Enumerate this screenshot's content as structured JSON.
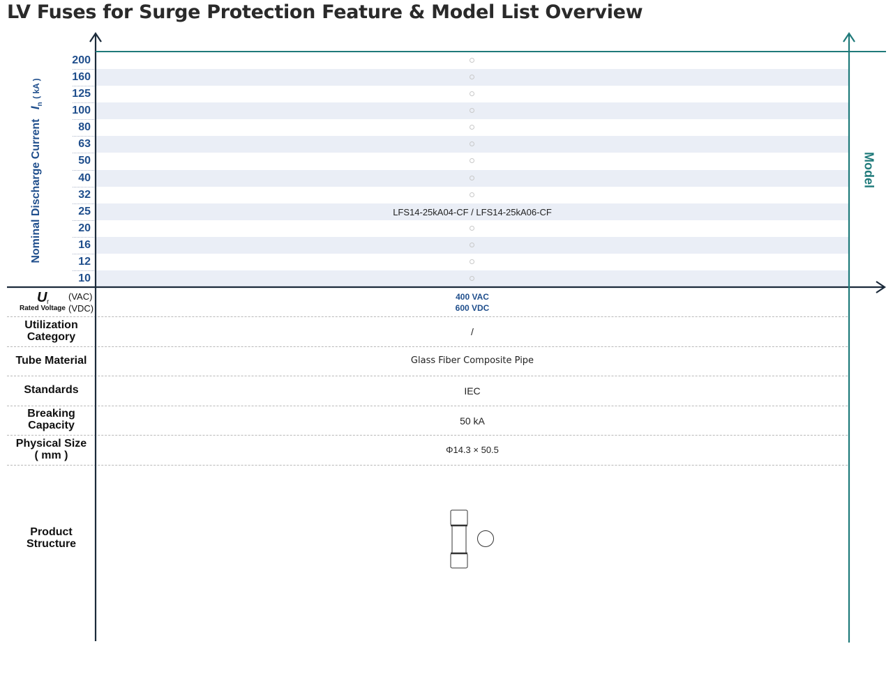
{
  "title": "LV Fuses for Surge Protection Feature & Model List Overview",
  "y_axis": {
    "symbol": "I",
    "subscript": "n",
    "label": "Nominal Discharge Current",
    "unit": "( kA )",
    "values": [
      "200",
      "160",
      "125",
      "100",
      "80",
      "63",
      "50",
      "40",
      "32",
      "25",
      "20",
      "16",
      "12",
      "10"
    ]
  },
  "model_axis_label": "Model",
  "model_rows": [
    {
      "current": "200",
      "model": ""
    },
    {
      "current": "160",
      "model": ""
    },
    {
      "current": "125",
      "model": ""
    },
    {
      "current": "100",
      "model": ""
    },
    {
      "current": "80",
      "model": ""
    },
    {
      "current": "63",
      "model": ""
    },
    {
      "current": "50",
      "model": ""
    },
    {
      "current": "40",
      "model": ""
    },
    {
      "current": "32",
      "model": ""
    },
    {
      "current": "25",
      "model": "LFS14-25kA04-CF / LFS14-25kA06-CF"
    },
    {
      "current": "20",
      "model": ""
    },
    {
      "current": "16",
      "model": ""
    },
    {
      "current": "12",
      "model": ""
    },
    {
      "current": "10",
      "model": ""
    }
  ],
  "rated_voltage": {
    "symbol": "U",
    "subscript": "r",
    "label": "Rated Voltage",
    "unit_ac": "(VAC)",
    "unit_dc": "(VDC)",
    "value_ac": "400 VAC",
    "value_dc": "600 VDC"
  },
  "features": {
    "utilization_category": {
      "label_line1": "Utilization",
      "label_line2": "Category",
      "value": "/"
    },
    "tube_material": {
      "label": "Tube Material",
      "value": "Glass Fiber Composite Pipe"
    },
    "standards": {
      "label": "Standards",
      "value": "IEC"
    },
    "breaking_capacity": {
      "label_line1": "Breaking",
      "label_line2": "Capacity",
      "value": "50 kA"
    },
    "physical_size": {
      "label_line1": "Physical Size",
      "label_line2": "( mm )",
      "value": "Φ14.3 × 50.5"
    },
    "product_structure": {
      "label_line1": "Product",
      "label_line2": "Structure"
    }
  },
  "colors": {
    "axis": "#1b2a3a",
    "model_axis": "#1f7a7a",
    "accent_blue": "#1f4e8c",
    "band": "#eaeef6"
  }
}
